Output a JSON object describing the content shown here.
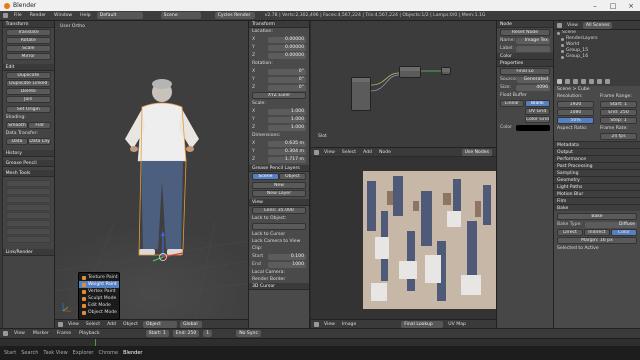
{
  "window": {
    "title": "Blender"
  },
  "info": {
    "menus": [
      "File",
      "Render",
      "Window",
      "Help"
    ],
    "layout": "Default",
    "scene": "Scene",
    "engine": "Cycles Render",
    "stats": "v2.78 | Verts:2,302,496 | Faces:4,567,224 | Tris:4,567,224 | Objects:1/2 | Lamps:0/0 | Mem:1.1G"
  },
  "toolshelf": {
    "transform_header": "Transform",
    "transform": [
      "Translate",
      "Rotate",
      "Scale",
      "Mirror"
    ],
    "edit_header": "Edit",
    "edit": [
      "Duplicate",
      "Duplicate Linked",
      "Delete",
      "Join"
    ],
    "set_origin": "Set Origin",
    "shading_label": "Shading:",
    "shading": [
      "Smooth",
      "Flat"
    ],
    "data_transfer_label": "Data Transfer:",
    "data_transfer": [
      "Data",
      "Data Layouts"
    ],
    "history_header": "History",
    "grease_header": "Grease Pencil",
    "mesh_tools_header": "Mesh Tools",
    "last_header": "Link/Render"
  },
  "viewport": {
    "label": "User Ortho",
    "bottom": [
      "View",
      "Select",
      "Add",
      "Object"
    ],
    "mode": "Object Mode",
    "pivot": "Global"
  },
  "mode_menu": {
    "items": [
      "Texture Paint",
      "Weight Paint",
      "Vertex Paint",
      "Sculpt Mode",
      "Edit Mode",
      "Object Mode"
    ],
    "selected": 1
  },
  "props": {
    "transform_header": "Transform",
    "location_label": "Location:",
    "location": [
      [
        "X",
        "0.00000"
      ],
      [
        "Y",
        "0.00000"
      ],
      [
        "Z",
        "0.00000"
      ]
    ],
    "rotation_label": "Rotation:",
    "rotation": [
      [
        "X",
        "0°"
      ],
      [
        "Y",
        "0°"
      ],
      [
        "Z",
        "0°"
      ]
    ],
    "rotation_mode": "XYZ Euler",
    "scale_label": "Scale:",
    "scale": [
      [
        "X",
        "1.000"
      ],
      [
        "Y",
        "1.000"
      ],
      [
        "Z",
        "1.000"
      ]
    ],
    "dimensions_label": "Dimensions:",
    "dimensions": [
      [
        "X",
        "0.635 m"
      ],
      [
        "Y",
        "0.304 m"
      ],
      [
        "Z",
        "1.717 m"
      ]
    ],
    "grease_header": "Grease Pencil Layers",
    "gp_tabs": [
      "Scene",
      "Object"
    ],
    "gp_new": "New",
    "gp_newlayer": "New Layer",
    "view_header": "View",
    "lens": "Lens: 35.000",
    "lock_to_object": "Lock to Object:",
    "lock_cursor": "Lock to Cursor",
    "lock_camera": "Lock Camera to View",
    "clip_label": "Clip:",
    "clip": [
      [
        "Start",
        "0.100"
      ],
      [
        "End",
        "1000"
      ]
    ],
    "local_camera": "Local Camera:",
    "render_border": "Render Border",
    "cursor_header": "3D Cursor"
  },
  "node_editor": {
    "bottom": [
      "View",
      "Select",
      "Add",
      "Node"
    ],
    "material_label": "Slot",
    "use_nodes": "Use Nodes"
  },
  "image_editor": {
    "bottom": [
      "View",
      "Image"
    ],
    "image_name": "Final Lookup",
    "uv_label": "UV Map"
  },
  "node_props": {
    "node_header": "Node",
    "reset_node": "Reset Node",
    "name_label": "Name:",
    "name": "Image Tex",
    "label_label": "Label:",
    "color_header": "Color",
    "props_header": "Properties",
    "image_value": "Final Lo",
    "source_label": "Source:",
    "source": "Generated",
    "size_label": "Size:",
    "size": "4096",
    "float_buffer": "Float Buffer",
    "type_options": [
      "Blank",
      "UV Grid",
      "Color Grid"
    ],
    "type_selected": 0,
    "linear_label": "Linear",
    "color_label": "Color"
  },
  "outliner": {
    "header_view": "View",
    "header_search": "All Scenes",
    "items": [
      "Scene",
      "RenderLayers",
      "World",
      "Group_15",
      "Group_16"
    ]
  },
  "propsR": {
    "breadcrumb": "Scene > Cube",
    "resolution_label": "Resolution:",
    "res_x": "1920",
    "res_y": "1080",
    "pct": "50%",
    "frame_range_label": "Frame Range:",
    "start": "Start: 1",
    "end": "End: 250",
    "step": "Step: 1",
    "aspect_label": "Aspect Ratio:",
    "frame_rate_label": "Frame Rate:",
    "fps": "24 fps",
    "sections": [
      "Metadata",
      "Output",
      "Performance",
      "Post Processing",
      "Sampling",
      "Geometry",
      "Light Paths",
      "Motion Blur",
      "Film",
      "Bake"
    ],
    "bake_type_label": "Bake Type:",
    "bake_type": "Diffuse",
    "influence": [
      "Direct",
      "Indirect",
      "Color"
    ],
    "margin": "Margin: 16 px",
    "selected_to_active": "Selected to Active",
    "bake_button": "Bake"
  },
  "timeline": {
    "menus": [
      "View",
      "Marker",
      "Frame",
      "Playback"
    ],
    "start": "Start: 1",
    "end": "End: 250",
    "frame": "1",
    "sync": "No Sync"
  },
  "taskbar": {
    "items": [
      "Start",
      "Search",
      "Task View",
      "Explorer",
      "Chrome",
      "Blender"
    ]
  }
}
